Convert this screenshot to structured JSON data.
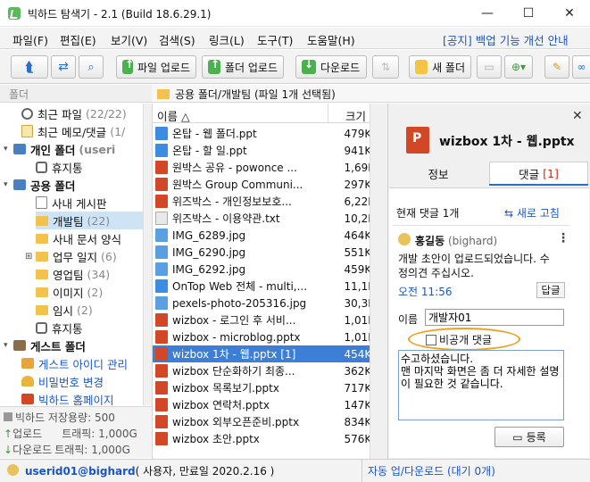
{
  "window": {
    "title": "빅하드 탐색기 - 2.1 (Build 18.6.29.1)",
    "minimize": "—",
    "maximize": "☐",
    "close": "✕"
  },
  "menu": {
    "items": [
      "파일(F)",
      "편집(E)",
      "보기(V)",
      "검색(S)",
      "링크(L)",
      "도구(T)",
      "도움말(H)"
    ],
    "notice": "[공지] 백업 기능 개선 안내"
  },
  "toolbar": {
    "file_upload": "파일 업로드",
    "folder_upload": "폴더 업로드",
    "download": "다운로드",
    "new_folder": "새 폴더"
  },
  "left_header": "폴더",
  "path": "공용 폴더/개발팀 (파일 1개 선택됨)",
  "tree": [
    {
      "label": "최근 파일",
      "count": "(22/22)"
    },
    {
      "label": "최근 메모/댓글",
      "count": "(1/"
    },
    {
      "label": "개인 폴더",
      "count": "(useri"
    },
    {
      "label": "휴지통",
      "count": ""
    },
    {
      "label": "공용 폴더",
      "count": ""
    },
    {
      "label": "사내 게시판",
      "count": ""
    },
    {
      "label": "개발팀",
      "count": "(22)"
    },
    {
      "label": "사내 문서 양식",
      "count": ""
    },
    {
      "label": "업무 일지",
      "count": "(6)"
    },
    {
      "label": "영업팀",
      "count": "(34)"
    },
    {
      "label": "이미지",
      "count": "(2)"
    },
    {
      "label": "임시",
      "count": "(2)"
    },
    {
      "label": "휴지통",
      "count": ""
    },
    {
      "label": "게스트 폴더",
      "count": ""
    },
    {
      "label": "게스트 아이디 관리",
      "count": ""
    },
    {
      "label": "비밀번호 변경",
      "count": ""
    },
    {
      "label": "빅하드 홈페이지",
      "count": ""
    }
  ],
  "stats": {
    "storage": "빅하드 저장용량: 500",
    "upload": "업로드",
    "upload_traffic": "트래픽: 1,000G",
    "download": "다운로드",
    "download_traffic": "트래픽: 1,000G"
  },
  "filelist": {
    "col_name": "이름 △",
    "col_size": "크기",
    "files": [
      {
        "name": "온탑 - 웹 폴더.ppt",
        "size": "479KE",
        "type": "web"
      },
      {
        "name": "온탑 - 할 일.ppt",
        "size": "941KE",
        "type": "web"
      },
      {
        "name": "원박스 공유 - powonce ...",
        "size": "1,69ME",
        "type": "ppt"
      },
      {
        "name": "원박스 Group Communi...",
        "size": "297KE",
        "type": "ppt"
      },
      {
        "name": "위즈박스 - 개인정보보호...",
        "size": "6,22KE",
        "type": "ppt"
      },
      {
        "name": "위즈박스 - 이용약관.txt",
        "size": "10,2KE",
        "type": "txt"
      },
      {
        "name": "IMG_6289.jpg",
        "size": "464KE",
        "type": "img"
      },
      {
        "name": "IMG_6290.jpg",
        "size": "551KE",
        "type": "img"
      },
      {
        "name": "IMG_6292.jpg",
        "size": "459KE",
        "type": "img"
      },
      {
        "name": "OnTop Web 전체 - multi,...",
        "size": "11,1ME",
        "type": "web"
      },
      {
        "name": "pexels-photo-205316.jpg",
        "size": "30,3KE",
        "type": "img"
      },
      {
        "name": "wizbox - 로그인 후 서비...",
        "size": "1,01ME",
        "type": "ppt"
      },
      {
        "name": "wizbox - microblog.pptx",
        "size": "1,01ME",
        "type": "ppt"
      },
      {
        "name": "wizbox 1차 - 웹.pptx [1]",
        "size": "454KE",
        "type": "ppt"
      },
      {
        "name": "wizbox 단순화하기 최종...",
        "size": "362KE",
        "type": "ppt"
      },
      {
        "name": "wizbox 목록보기.pptx",
        "size": "717KE",
        "type": "ppt"
      },
      {
        "name": "wizbox 연락처.pptx",
        "size": "147KE",
        "type": "ppt"
      },
      {
        "name": "wizbox 외부오픈준비.pptx",
        "size": "834KE",
        "type": "ppt"
      },
      {
        "name": "wizbox 초안.pptx",
        "size": "576KE",
        "type": "ppt"
      }
    ]
  },
  "panel": {
    "close": "✕",
    "file_title": "wizbox 1차 - 웹.pptx",
    "tab_info": "정보",
    "tab_comments": "댓글",
    "tab_comments_count": "[1]",
    "comment_count": "현재 댓글 1개",
    "refresh": "새로 고침",
    "author": "홍길동",
    "author_id": "(bighard)",
    "comment_text": "개발 초안이 업로드되었습니다. 수정의견 주십시오.",
    "comment_time": "오전 11:56",
    "reply": "답글",
    "name_label": "이름",
    "name_value": "개발자01",
    "private_label": "비공개 댓글",
    "textarea": "수고하셨습니다.\n맨 마지막 화면은 좀 더 자세한 설명이 필요한 것 같습니다.",
    "submit": "등록"
  },
  "status": {
    "user": "userid01@bighard",
    "user_info": "( 사용자, 만료일 2020.2.16 )",
    "transfer": "자동 업/다운로드 (대기 0개)"
  }
}
